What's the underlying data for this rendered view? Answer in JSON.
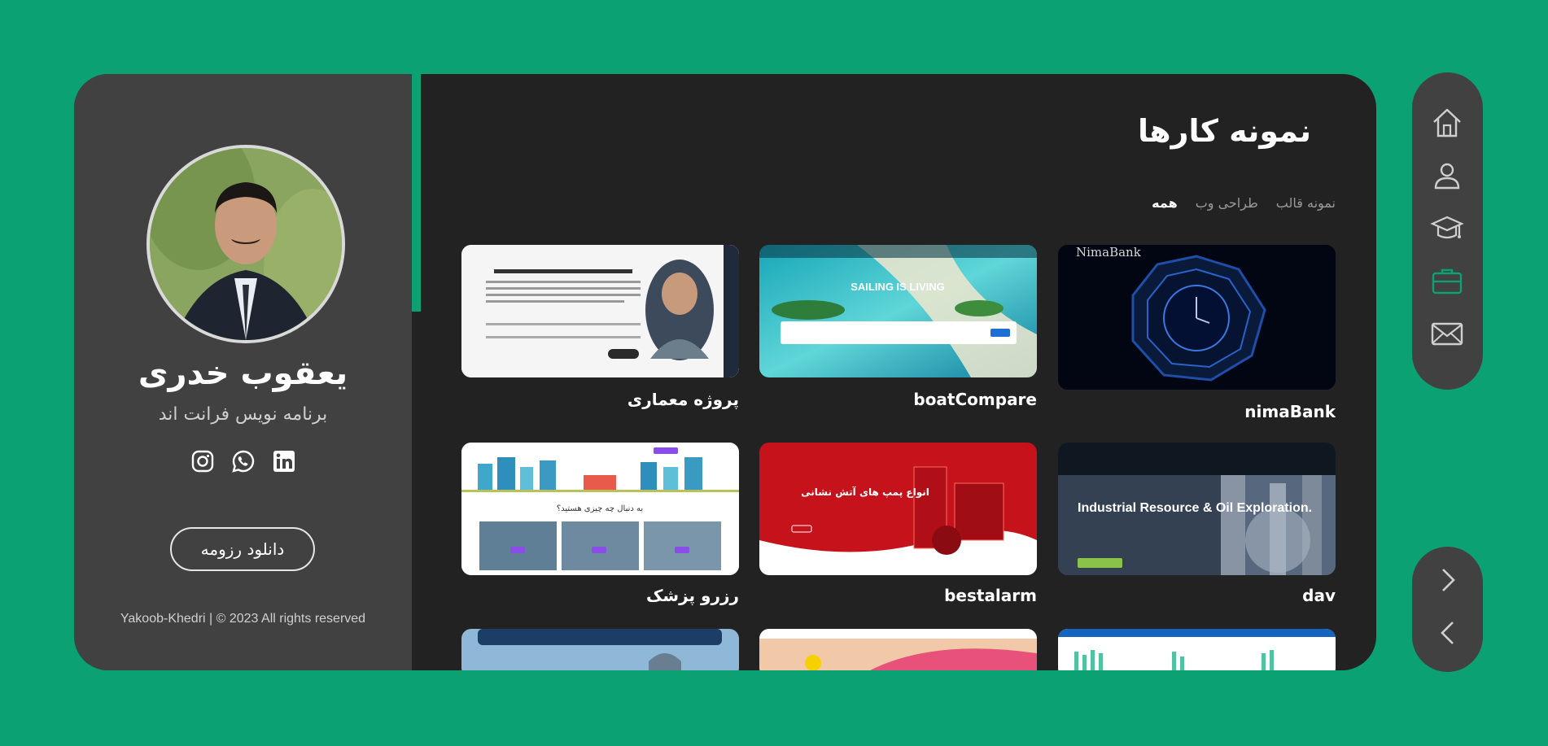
{
  "profile": {
    "name": "یعقوب خدری",
    "role": "برنامه نویس فرانت اند",
    "resume_button": "دانلود رزومه",
    "footer": "Yakoob-Khedri | © 2023 All rights reserved",
    "socials": [
      "instagram-icon",
      "whatsapp-icon",
      "linkedin-icon"
    ]
  },
  "portfolio": {
    "title": "نمونه کارها",
    "filters": [
      {
        "label": "همه",
        "active": true
      },
      {
        "label": "طراحی وب",
        "active": false
      },
      {
        "label": "نمونه قالب",
        "active": false
      }
    ],
    "items": [
      {
        "caption": "nimaBank",
        "thumb_text": "NimaBank"
      },
      {
        "caption": "boatCompare",
        "thumb_text": "SAILING IS LIVING"
      },
      {
        "caption": "پروژه معماری"
      },
      {
        "caption": "dav",
        "thumb_text": "Industrial Resource & Oil Exploration."
      },
      {
        "caption": "bestalarm",
        "thumb_text": "انواع پمپ های آتش نشانی"
      },
      {
        "caption": "رزرو پزشک",
        "thumb_text": "به دنبال چه چیزی هستید؟"
      }
    ]
  },
  "nav": {
    "items": [
      "home-icon",
      "user-icon",
      "graduation-cap-icon",
      "briefcase-icon",
      "envelope-icon"
    ],
    "active": "briefcase-icon"
  },
  "colors": {
    "brand": "#0ba172",
    "panel": "#414141",
    "card": "#222222"
  }
}
